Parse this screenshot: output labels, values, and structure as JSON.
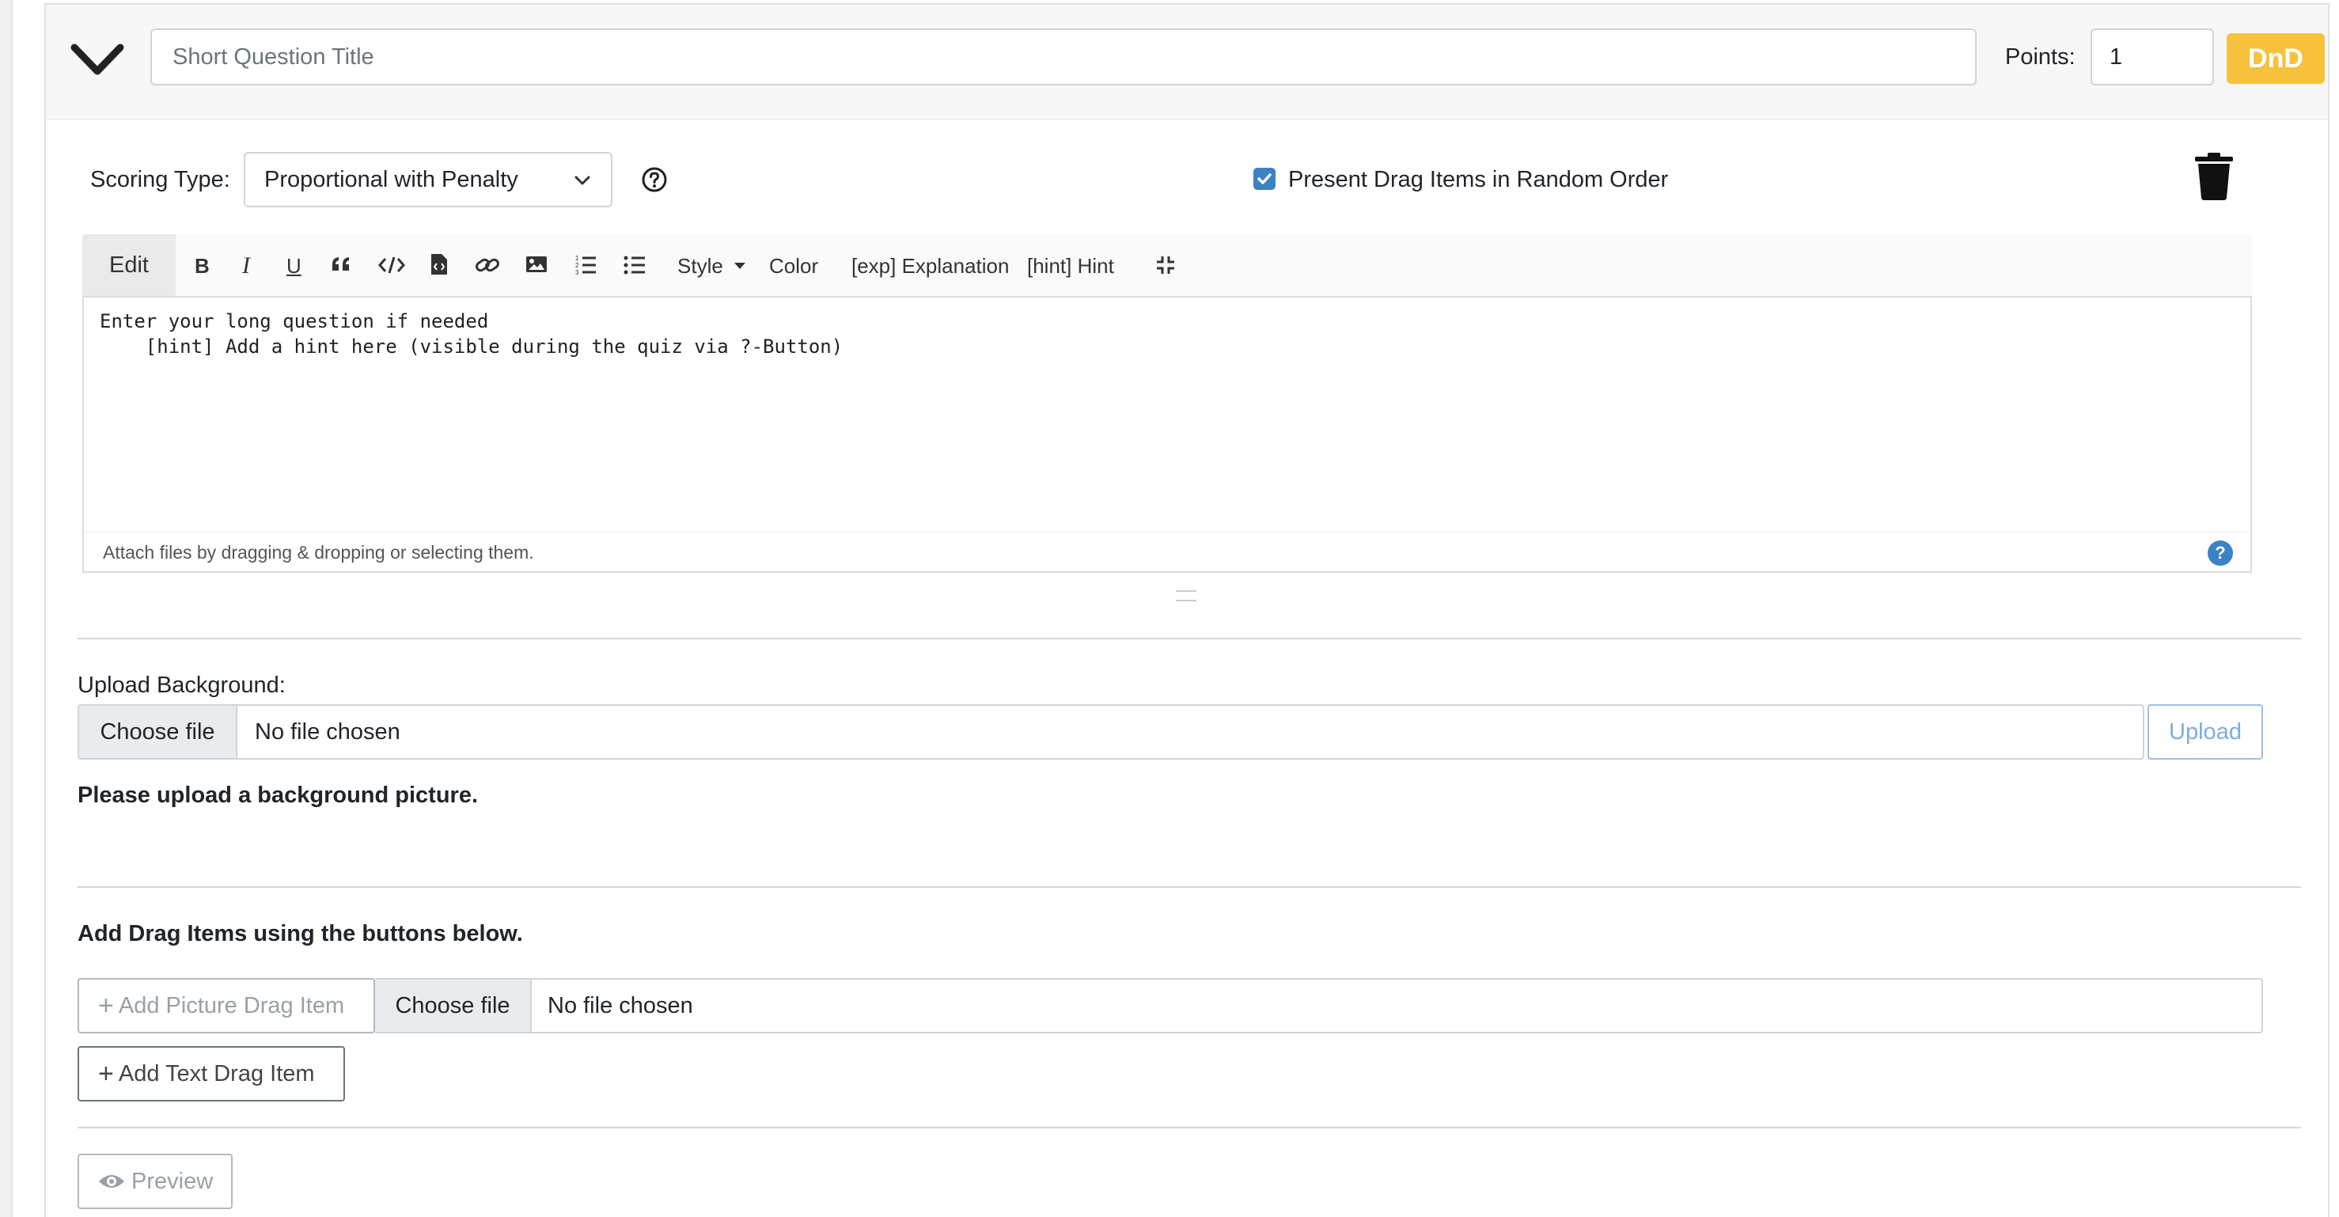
{
  "header": {
    "title_placeholder": "Short Question Title",
    "points_label": "Points:",
    "points_value": "1",
    "type_badge": "DnD",
    "collapse_icon": "chevron-down-icon"
  },
  "settings": {
    "scoring_label": "Scoring Type:",
    "scoring_value": "Proportional with Penalty",
    "random_order_label": "Present Drag Items in Random Order",
    "random_order_checked": true
  },
  "editor": {
    "tab_label": "Edit",
    "toolbar": {
      "bold": "B",
      "italic": "I",
      "underline": "U",
      "style": "Style",
      "color": "Color",
      "explanation": "[exp] Explanation",
      "hint": "[hint] Hint"
    },
    "content_line1": "Enter your long question if needed",
    "content_line2": "    [hint] Add a hint here (visible during the quiz via ?-Button)",
    "footer_text": "Attach files by dragging & dropping or selecting them.",
    "footer_help": "?"
  },
  "background_upload": {
    "label": "Upload Background:",
    "choose_file": "Choose file",
    "file_status": "No file chosen",
    "upload_button": "Upload",
    "message": "Please upload a background picture."
  },
  "drag_items": {
    "message": "Add Drag Items using the buttons below.",
    "add_picture_button": "Add Picture Drag Item",
    "choose_file": "Choose file",
    "file_status": "No file chosen",
    "add_text_button": "Add Text Drag Item"
  },
  "preview_button": "Preview",
  "colors": {
    "badge": "#f6c23e",
    "checkbox": "#3b82c4"
  }
}
